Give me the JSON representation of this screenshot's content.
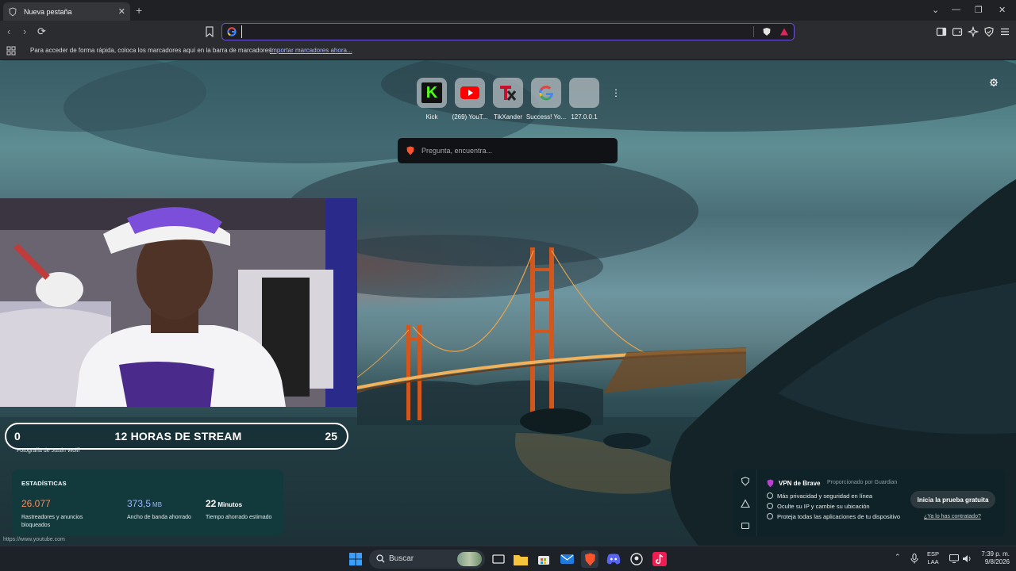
{
  "tab": {
    "title": "Nueva pestaña",
    "close": "✕"
  },
  "new_tab": "+",
  "window_controls": {
    "list": "⌄",
    "minimize": "—",
    "maximize": "❐",
    "close": "✕"
  },
  "toolbar": {
    "back": "‹",
    "forward": "›",
    "reload": "⟳",
    "address_value": "",
    "address_placeholder": ""
  },
  "bookmarks_bar": {
    "message": "Para acceder de forma rápida, coloca los marcadores aquí en la barra de marcadores",
    "import_link": "Importar marcadores ahora..."
  },
  "top_sites": [
    {
      "label": "Kick",
      "icon": "kick-icon"
    },
    {
      "label": "(269) YouT...",
      "icon": "youtube-icon"
    },
    {
      "label": "TikXander",
      "icon": "tikxander-icon"
    },
    {
      "label": "Success! Yo...",
      "icon": "google-icon"
    },
    {
      "label": "127.0.0.1",
      "icon": "blank-site-icon"
    }
  ],
  "search": {
    "placeholder": "Pregunta, encuentra..."
  },
  "stream_overlay": {
    "left_number": "0",
    "title": "12 HORAS DE STREAM",
    "right_number": "25"
  },
  "photo_credit": "Fotografía de Justin Wolff",
  "stats": {
    "title": "ESTADÍSTICAS",
    "items": [
      {
        "value": "26.077",
        "unit": "",
        "desc": "Rastreadores y anuncios bloqueados",
        "color": "#ff8a5c"
      },
      {
        "value": "373,5",
        "unit": "MB",
        "desc": "Ancho de banda ahorrado",
        "color": "#a0b4ff"
      },
      {
        "value": "22",
        "unit": "Minutos",
        "desc": "Tiempo ahorrado estimado",
        "color": "#ffffff"
      }
    ]
  },
  "status_url": "https://www.youtube.com",
  "vpn": {
    "title": "VPN de Brave",
    "powered_by": "Proporcionado por  Guardian",
    "features": [
      "Más privacidad y seguridad en línea",
      "Oculte su IP y cambie su ubicación",
      "Proteja todas las aplicaciones de tu dispositivo"
    ],
    "cta": "Inicia la prueba gratuita",
    "already": "¿Ya lo has contratado?"
  },
  "taskbar": {
    "search_label": "Buscar",
    "language_line1": "ESP",
    "language_line2": "LAA",
    "time": "7:39 p. m.",
    "date": "9/8/2026",
    "tray_chevron": "⌃"
  },
  "colors": {
    "accent": "#6d54d9",
    "kick_green": "#53fc18",
    "youtube_red": "#ff0000",
    "brave_orange": "#fb542b"
  }
}
